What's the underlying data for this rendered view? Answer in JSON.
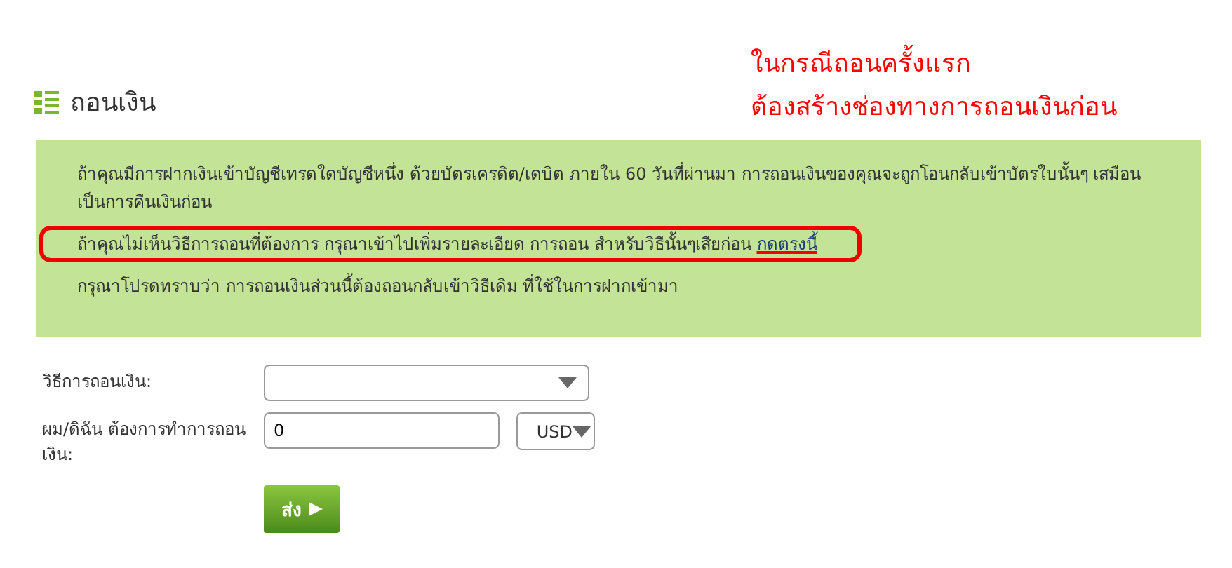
{
  "annotation": {
    "lines": [
      "ในกรณีถอนครั้งแรก",
      "ต้องสร้างช่องทางการถอนเงินก่อน"
    ]
  },
  "heading": {
    "title": "ถอนเงิน"
  },
  "notices": [
    {
      "text": "ถ้าคุณมีการฝากเงินเข้าบัญชีเทรดใดบัญชีหนึ่ง  ด้วยบัตรเครดิต/เดบิต  ภายใน  60  วันที่ผ่านมา  การถอนเงินของคุณจะถูกโอนกลับเข้าบัตรใบนั้นๆ เสมือนเป็นการคืนเงินก่อน",
      "highlighted": false
    },
    {
      "text": "ถ้าคุณไม่เห็นวิธีการถอนที่ต้องการ กรุณาเข้าไปเพิ่มรายละเอียด การถอน สำหรับวิธีนั้นๆเสียก่อน",
      "link": "กดตรงนี้",
      "highlighted": true
    },
    {
      "text": "กรุณาโปรดทราบว่า การถอนเงินส่วนนี้ต้องถอนกลับเข้าวิธีเดิม ที่ใช้ในการฝากเข้ามา",
      "highlighted": false
    }
  ],
  "form": {
    "fields": [
      {
        "kind": "select",
        "label": "วิธีการถอนเงิน:"
      },
      {
        "kind": "amount",
        "label": "ผม/ดิฉัน ต้องการทำการถอนเงิน:",
        "value": "0",
        "currency": "USD"
      }
    ],
    "submit": {
      "label": "ส่ง"
    }
  }
}
